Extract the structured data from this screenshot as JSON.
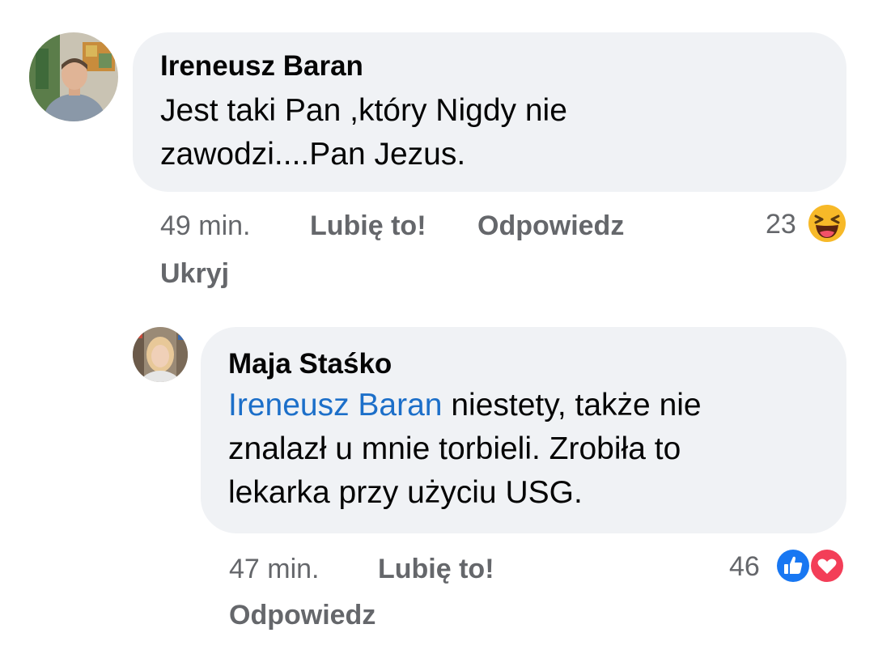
{
  "comments": [
    {
      "author": "Ireneusz Baran",
      "text_lines": [
        "Jest taki Pan ,który Nigdy nie",
        "zawodzi....Pan Jezus."
      ],
      "time": "49 min.",
      "like_label": "Lubię to!",
      "reply_label": "Odpowiedz",
      "hide_label": "Ukryj",
      "reaction_count": "23",
      "reaction_icons": [
        "haha-emoji-icon"
      ]
    },
    {
      "author": "Maja Staśko",
      "mention": "Ireneusz Baran",
      "text_line1_rest": " niestety, także nie",
      "text_lines": [
        "znalazł u mnie torbieli. Zrobiła to",
        "lekarka przy użyciu USG."
      ],
      "time": "47 min.",
      "like_label": "Lubię to!",
      "reply_label": "Odpowiedz",
      "reaction_count": "46",
      "reaction_icons": [
        "like-icon",
        "love-heart-icon"
      ]
    }
  ],
  "colors": {
    "bubble": "#f0f2f5",
    "mention": "#1c6fc9",
    "secondary_text": "#65676b",
    "like_blue": "#1877f2",
    "love_red": "#f33e58",
    "haha_yellow": "#f7b928"
  }
}
